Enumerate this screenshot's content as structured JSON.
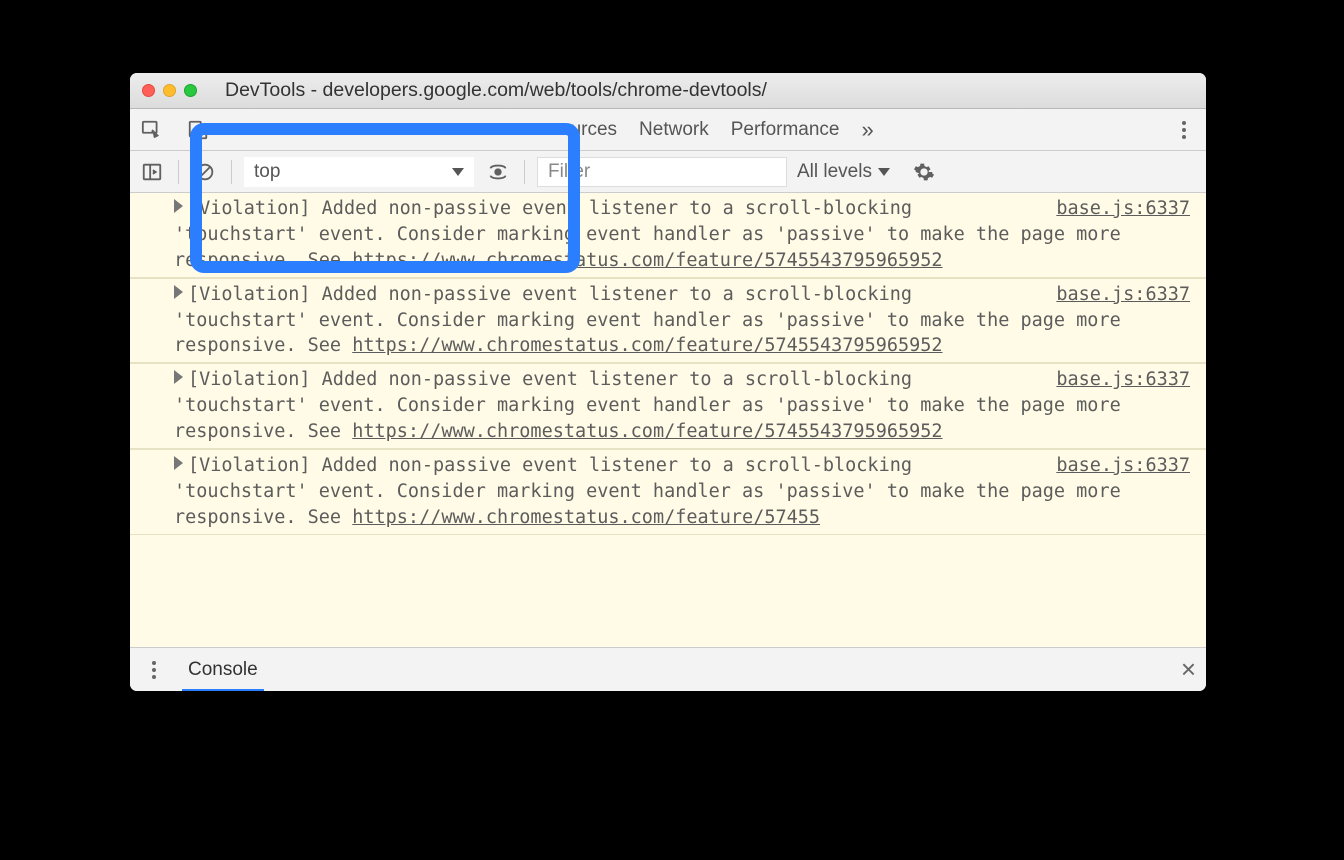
{
  "window": {
    "title": "DevTools - developers.google.com/web/tools/chrome-devtools/"
  },
  "tabs": {
    "sources": "ources",
    "network": "Network",
    "performance": "Performance",
    "overflow_glyph": "»"
  },
  "console_toolbar": {
    "context": "top",
    "filter_placeholder": "Filter",
    "levels_label": "All levels"
  },
  "messages": [
    {
      "prefix": "[Violation]",
      "body_lead": " Added non-passive event listener to a scroll-blocking 'touchstart' event. Consider marking event handler as 'passive' to make the page more responsive. See ",
      "link": "https://www.chromestatus.com/feature/5745543795965952",
      "source": "base.js:6337"
    },
    {
      "prefix": "[Violation]",
      "body_lead": " Added non-passive event listener to a scroll-blocking 'touchstart' event. Consider marking event handler as 'passive' to make the page more responsive. See ",
      "link": "https://www.chromestatus.com/feature/5745543795965952",
      "source": "base.js:6337"
    },
    {
      "prefix": "[Violation]",
      "body_lead": " Added non-passive event listener to a scroll-blocking 'touchstart' event. Consider marking event handler as 'passive' to make the page more responsive. See ",
      "link": "https://www.chromestatus.com/feature/5745543795965952",
      "source": "base.js:6337"
    },
    {
      "prefix": "[Violation]",
      "body_lead": " Added non-passive event listener to a scroll-blocking 'touchstart' event. Consider marking event handler as 'passive' to make the page more responsive. See ",
      "link": "https://www.chromestatus.com/feature/57455",
      "source": "base.js:6337"
    }
  ],
  "drawer": {
    "tab": "Console",
    "close_glyph": "×"
  }
}
